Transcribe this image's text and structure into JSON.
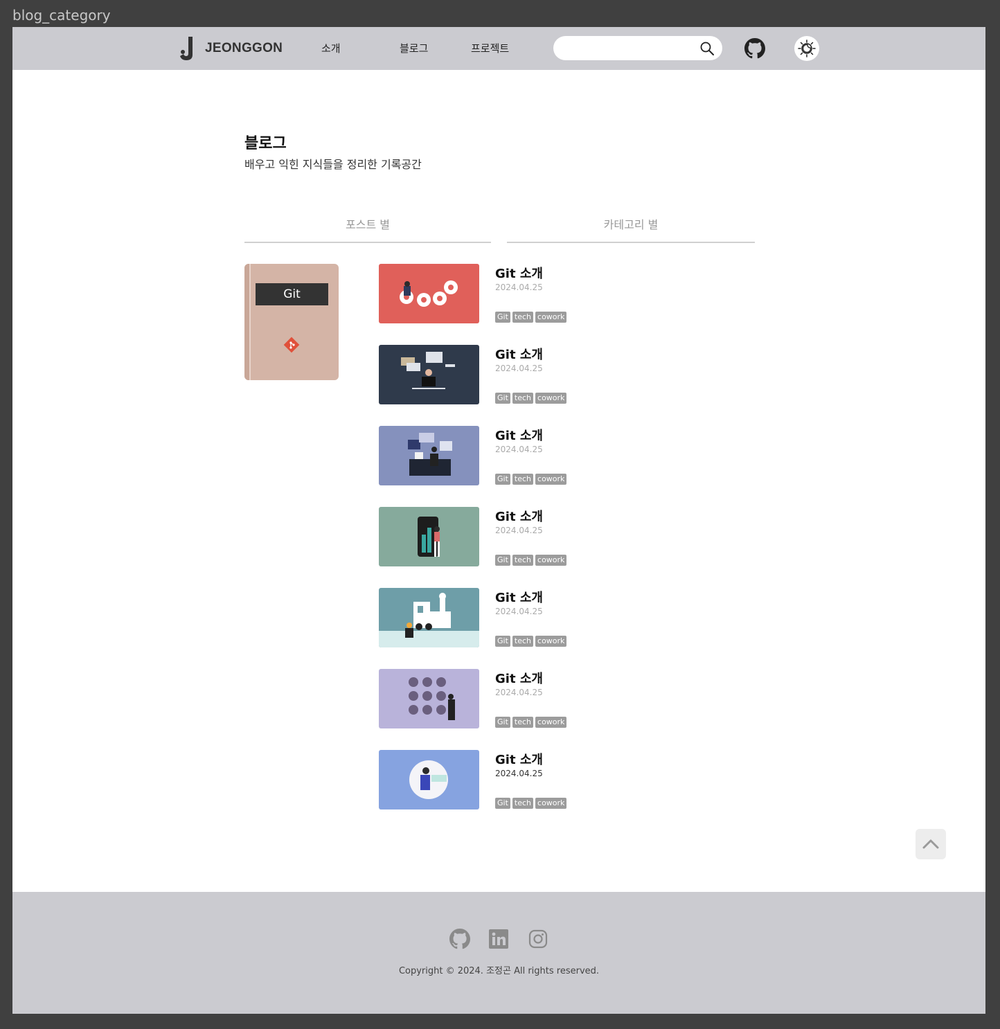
{
  "window": {
    "label": "blog_category"
  },
  "header": {
    "logo_text": "JEONGGON",
    "nav": [
      {
        "label": "소개"
      },
      {
        "label": "블로그"
      },
      {
        "label": "프로젝트"
      }
    ],
    "search": {
      "value": "",
      "placeholder": ""
    },
    "icons": [
      "search-icon",
      "github-icon",
      "theme-toggle-icon"
    ]
  },
  "main": {
    "title": "블로그",
    "subtitle": "배우고 익힌 지식들을 정리한 기록공간",
    "tabs": [
      {
        "label": "포스트 별"
      },
      {
        "label": "카테고리 별"
      }
    ],
    "category": {
      "label": "Git",
      "color": "#d4b4a6"
    },
    "posts": [
      {
        "title": "Git 소개",
        "date": "2024.04.25",
        "tags": [
          "Git",
          "tech",
          "cowork"
        ],
        "thumb_color": "#e0605a"
      },
      {
        "title": "Git 소개",
        "date": "2024.04.25",
        "tags": [
          "Git",
          "tech",
          "cowork"
        ],
        "thumb_color": "#2f3a4b"
      },
      {
        "title": "Git 소개",
        "date": "2024.04.25",
        "tags": [
          "Git",
          "tech",
          "cowork"
        ],
        "thumb_color": "#8591bd"
      },
      {
        "title": "Git 소개",
        "date": "2024.04.25",
        "tags": [
          "Git",
          "tech",
          "cowork"
        ],
        "thumb_color": "#86aa9c"
      },
      {
        "title": "Git 소개",
        "date": "2024.04.25",
        "tags": [
          "Git",
          "tech",
          "cowork"
        ],
        "thumb_color": "#6e9ea8"
      },
      {
        "title": "Git 소개",
        "date": "2024.04.25",
        "tags": [
          "Git",
          "tech",
          "cowork"
        ],
        "thumb_color": "#b9b3da"
      },
      {
        "title": "Git 소개",
        "date": "2024.04.25",
        "tags": [
          "Git",
          "tech",
          "cowork"
        ],
        "thumb_color": "#86a3e0"
      }
    ]
  },
  "footer": {
    "icons": [
      "github-icon",
      "linkedin-icon",
      "instagram-icon"
    ],
    "copyright": "Copyright © 2024. 조정곤 All rights reserved."
  }
}
